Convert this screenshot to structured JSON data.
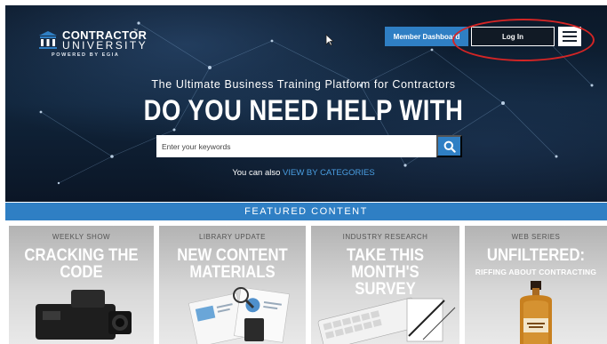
{
  "logo": {
    "line1": "CONTRACTOR",
    "tm": "™",
    "line2": "UNIVERSITY",
    "line3": "POWERED BY EGIA"
  },
  "header": {
    "member_dashboard_label": "Member Dashboard",
    "login_label": "Log In"
  },
  "hero": {
    "tagline": "The Ultimate Business Training Platform for Contractors",
    "headline": "DO YOU NEED HELP WITH",
    "search_placeholder": "Enter your keywords",
    "also_prefix": "You can also",
    "also_link": "VIEW BY CATEGORIES"
  },
  "featured": {
    "label": "FEATURED CONTENT",
    "cards": [
      {
        "kicker": "WEEKLY SHOW",
        "title_line1": "CRACKING THE",
        "title_line2": "CODE"
      },
      {
        "kicker": "LIBRARY UPDATE",
        "title_line1": "NEW CONTENT",
        "title_line2": "MATERIALS"
      },
      {
        "kicker": "INDUSTRY RESEARCH",
        "title_line1": "TAKE THIS",
        "title_line2": "MONTH'S SURVEY"
      },
      {
        "kicker": "WEB SERIES",
        "title_line1": "UNFILTERED:",
        "subtitle": "RIFFING ABOUT CONTRACTING"
      }
    ]
  },
  "icons": {
    "logo": "building-columns-icon",
    "search": "search-icon",
    "menu": "hamburger-menu-icon",
    "cursor": "mouse-cursor-icon"
  },
  "colors": {
    "brand_blue": "#2f7fc4",
    "hero_dark": "#10243a",
    "highlight_red": "#d42525",
    "link_blue": "#4a9ee2"
  }
}
